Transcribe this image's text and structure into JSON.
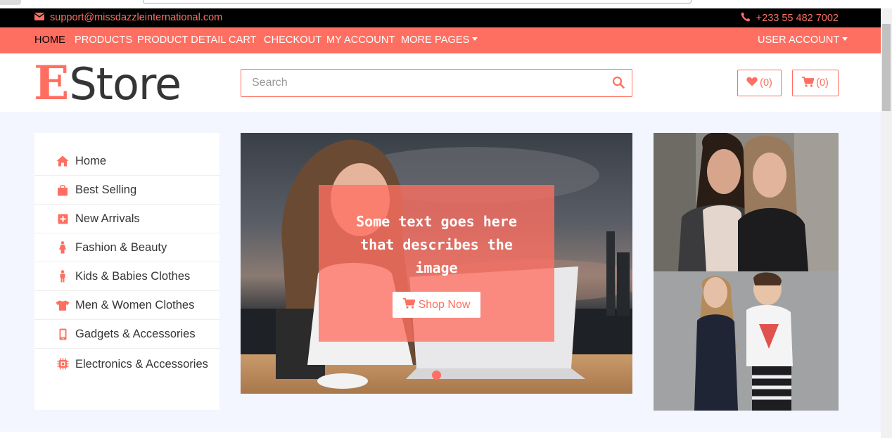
{
  "topbar": {
    "email": "support@missdazzleinternational.com",
    "phone": "+233 55 482 7002"
  },
  "nav": {
    "items": [
      "HOME",
      "PRODUCTS",
      "PRODUCT DETAIL",
      "CART",
      "CHECKOUT",
      "MY ACCOUNT",
      "MORE PAGES"
    ],
    "active": "HOME",
    "user_account": "USER ACCOUNT"
  },
  "header": {
    "logo_e": "E",
    "logo_rest": "Store",
    "search_placeholder": "Search",
    "wishlist_count": "(0)",
    "cart_count": "(0)"
  },
  "sidebar": {
    "items": [
      {
        "label": "Home",
        "icon": "home-icon"
      },
      {
        "label": "Best Selling",
        "icon": "shopping-bag-icon"
      },
      {
        "label": "New Arrivals",
        "icon": "plus-square-icon"
      },
      {
        "label": "Fashion & Beauty",
        "icon": "female-icon"
      },
      {
        "label": "Kids & Babies Clothes",
        "icon": "child-icon"
      },
      {
        "label": "Men & Women Clothes",
        "icon": "tshirt-icon"
      },
      {
        "label": "Gadgets & Accessories",
        "icon": "mobile-icon"
      },
      {
        "label": "Electronics & Accessories",
        "icon": "microchip-icon"
      }
    ]
  },
  "slider": {
    "caption": "Some text goes here that describes the image",
    "button": "Shop Now"
  },
  "colors": {
    "accent": "#ff6f61",
    "topbar_bg": "#000000",
    "content_bg": "#f3f6ff"
  }
}
